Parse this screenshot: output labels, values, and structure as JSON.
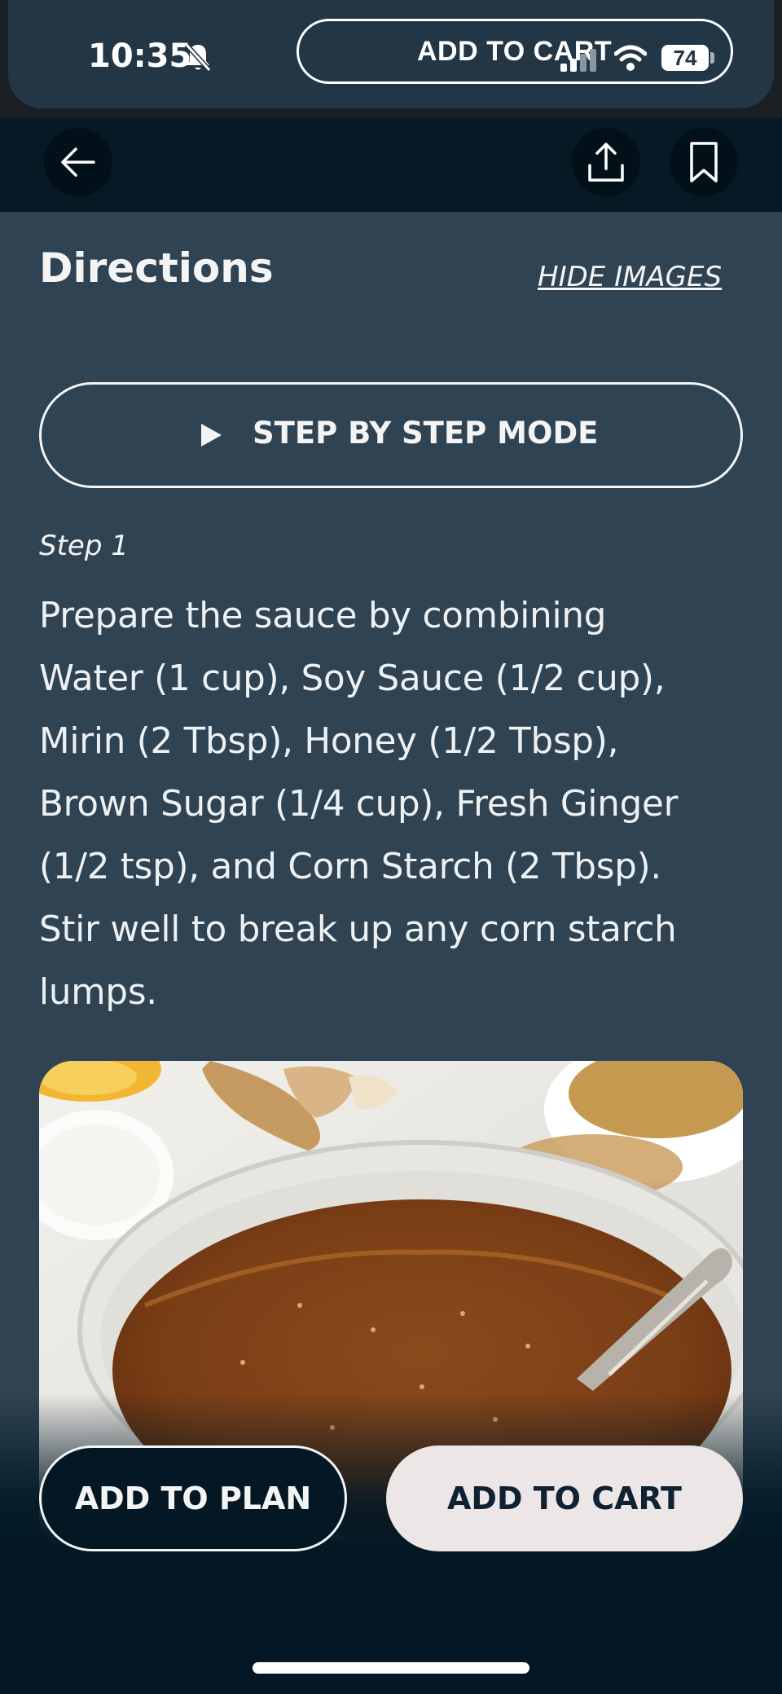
{
  "status_bar": {
    "time": "10:35",
    "pill_label": "ADD TO CART",
    "battery": "74",
    "icons": [
      "bell-off-icon",
      "signal-icon",
      "wifi-icon",
      "battery-icon"
    ]
  },
  "nav": {
    "icons": [
      "back-arrow-icon",
      "share-icon",
      "bookmark-icon"
    ]
  },
  "directions": {
    "title": "Directions",
    "hide_images": "HIDE IMAGES",
    "step_mode_label": "STEP BY STEP MODE",
    "steps": [
      {
        "label": "Step 1",
        "text": "Prepare the sauce by combining\nWater (1 cup), Soy Sauce (1/2 cup),\nMirin (2 Tbsp), Honey (1/2 Tbsp),\nBrown Sugar (1/4 cup), Fresh Ginger\n(1/2 tsp), and Corn Starch (2 Tbsp).\nStir well to break up any corn starch\nlumps."
      }
    ]
  },
  "actions": {
    "add_to_plan": "ADD TO PLAN",
    "add_to_cart": "ADD TO CART"
  },
  "colors": {
    "background": "#2f4353",
    "nav_background": "#061925",
    "text": "#f4f4f4",
    "cart_button": "#ece6e6",
    "cart_text": "#0f2233"
  }
}
